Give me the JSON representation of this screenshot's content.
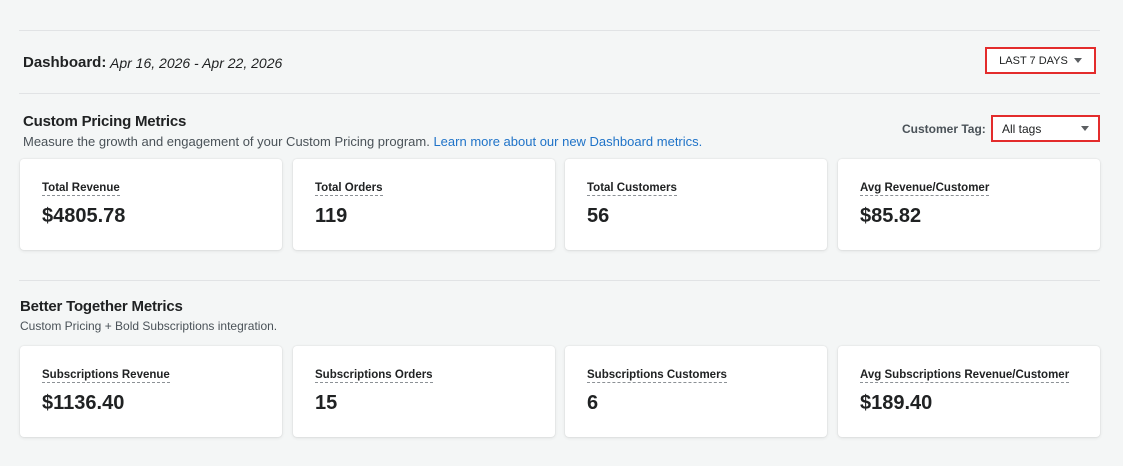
{
  "header": {
    "title": "Dashboard:",
    "date_range": "Apr 16, 2026 - Apr 22, 2026",
    "period_selector": {
      "label": "LAST 7 DAYS"
    }
  },
  "custom_pricing": {
    "title": "Custom Pricing Metrics",
    "description": "Measure the growth and engagement of your Custom Pricing program.",
    "link_text": "Learn more about our new Dashboard metrics.",
    "tag_filter": {
      "label": "Customer Tag:",
      "value": "All tags"
    },
    "metrics": [
      {
        "label": "Total Revenue",
        "value": "$4805.78"
      },
      {
        "label": "Total Orders",
        "value": "119"
      },
      {
        "label": "Total Customers",
        "value": "56"
      },
      {
        "label": "Avg Revenue/Customer",
        "value": "$85.82"
      }
    ]
  },
  "better_together": {
    "title": "Better Together Metrics",
    "description": "Custom Pricing + Bold Subscriptions integration.",
    "metrics": [
      {
        "label": "Subscriptions Revenue",
        "value": "$1136.40"
      },
      {
        "label": "Subscriptions Orders",
        "value": "15"
      },
      {
        "label": "Subscriptions Customers",
        "value": "6"
      },
      {
        "label": "Avg Subscriptions Revenue/Customer",
        "value": "$189.40"
      }
    ]
  },
  "colors": {
    "background": "#f4f6f6",
    "highlight_border": "#e32c2c",
    "link": "#1f73c8"
  },
  "icons": {
    "dropdown": "caret-down-icon"
  }
}
